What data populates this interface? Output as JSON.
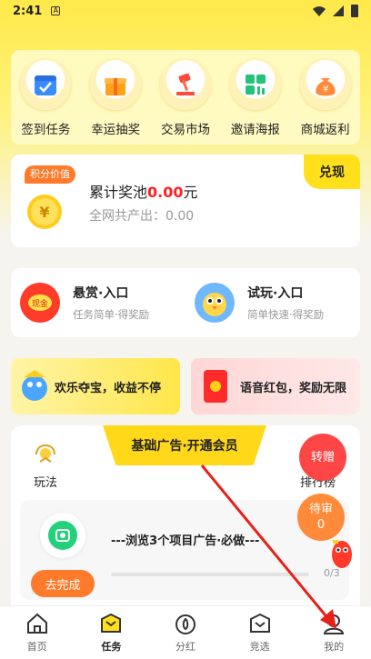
{
  "status_bar": {
    "time": "2:41"
  },
  "top_menu": [
    {
      "label": "签到任务",
      "icon": "calendar-check-icon"
    },
    {
      "label": "幸运抽奖",
      "icon": "gift-icon"
    },
    {
      "label": "交易市场",
      "icon": "gavel-icon"
    },
    {
      "label": "邀请海报",
      "icon": "poster-icon"
    },
    {
      "label": "商城返利",
      "icon": "money-bag-icon"
    }
  ],
  "pool": {
    "tag": "积分价值",
    "title_prefix": "累计奖池",
    "amount": "0.00",
    "unit": "元",
    "sub": "全网共产出：0.00",
    "redeem": "兑现"
  },
  "entries": [
    {
      "title": "悬赏·入口",
      "sub": "任务简单·得奖励"
    },
    {
      "title": "试玩·入口",
      "sub": "简单快速·得奖励"
    }
  ],
  "banners": [
    {
      "text": "欢乐夺宝，收益不停"
    },
    {
      "text": "语音红包，奖励无限"
    }
  ],
  "vip_tab": "基础广告·开通会员",
  "rules_label": "玩法",
  "rank_label": "排行榜",
  "float_gift": "转赠",
  "float_pending": {
    "label": "待审",
    "count": "0"
  },
  "task": {
    "title": "---浏览3个项目广告·必做---",
    "button": "去完成",
    "progress_text": "0/3",
    "progress": 0
  },
  "bottom_nav": [
    {
      "label": "首页",
      "icon": "home-icon",
      "active": false
    },
    {
      "label": "任务",
      "icon": "task-icon",
      "active": true
    },
    {
      "label": "分红",
      "icon": "dividend-icon",
      "active": false
    },
    {
      "label": "竞选",
      "icon": "election-icon",
      "active": false
    },
    {
      "label": "我的",
      "icon": "profile-icon",
      "active": false
    }
  ],
  "colors": {
    "accent": "#ffe01a",
    "highlight": "#ff2020",
    "orange": "#ff7a2a"
  }
}
